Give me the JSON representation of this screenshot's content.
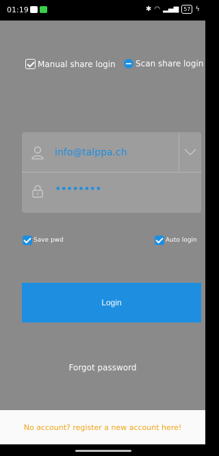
{
  "status": {
    "time": "01:19",
    "battery": "57"
  },
  "options": {
    "manual_label": "Manual share login",
    "scan_label": "Scan share login"
  },
  "form": {
    "username": "info@talppa.ch",
    "password_masked": "••••••••"
  },
  "checkboxes": {
    "save_pwd": "Save pwd",
    "auto_login": "Auto login"
  },
  "actions": {
    "login": "Login",
    "forgot": "Forgot password",
    "register": "No account? register a new account here!"
  },
  "colors": {
    "accent": "#1e8fe0",
    "overlay": "#8a8a8a",
    "register_text": "#f0a416"
  }
}
